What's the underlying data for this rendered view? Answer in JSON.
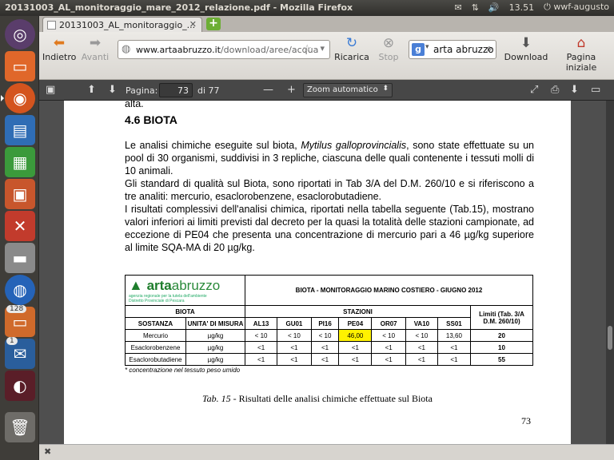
{
  "topbar": {
    "title": "20131003_AL_monitoraggio_mare_2012_relazione.pdf - Mozilla Firefox",
    "time": "13.51",
    "user": "wwf-augusto"
  },
  "launcher": {
    "badge_files": "128",
    "badge_thunderbird": "1"
  },
  "tab": {
    "title": "20131003_AL_monitoraggio_..."
  },
  "nav": {
    "back": "Indietro",
    "forward": "Avanti",
    "reload": "Ricarica",
    "stop": "Stop",
    "download": "Download",
    "home": "Pagina iniziale"
  },
  "url": {
    "domain": "www.artaabruzzo.it",
    "path": "/download/aree/acqua"
  },
  "search": {
    "value": "arta abruzzo"
  },
  "pdf": {
    "page_label": "Pagina:",
    "page_value": "73",
    "page_of": "di 77",
    "zoom": "Zoom automatico"
  },
  "doc": {
    "prev_line": "alta.",
    "heading": "4.6 BIOTA",
    "p1_pre": "Le analisi chimiche eseguite sul biota, ",
    "p1_species": "Mytilus galloprovincialis",
    "p1_post": ", sono state effettuate su un pool di 30 organismi, suddivisi in 3 repliche, ciascuna delle quali contenente i tessuti molli di 10 animali.",
    "p2": "Gli standard di qualità sul Biota, sono riportati in Tab 3/A del D.M. 260/10 e si riferiscono a tre analiti: mercurio, esaclorobenzene, esaclorobutadiene.",
    "p3": "I risultati complessivi dell'analisi chimica, riportati nella tabella seguente (Tab.15), mostrano valori inferiori ai limiti previsti dal decreto per la quasi la totalità delle stazioni campionate, ad eccezione di PE04 che presenta una concentrazione di mercurio pari a 46 µg/kg superiore al limite SQA-MA di 20 µg/kg.",
    "table": {
      "logo_bold": "arta",
      "logo_light": "abruzzo",
      "logo_sub1": "agenzia regionale per la tutela dell'ambiente",
      "logo_sub2": "Distretto Provinciale di Pescara",
      "title": "BIOTA - MONITORAGGIO MARINO COSTIERO - GIUGNO 2012",
      "biota": "BIOTA",
      "stazioni": "STAZIONI",
      "limit": "Limiti (Tab. 3/A D.M. 260/10)",
      "col_sostanza": "SOSTANZA",
      "col_unita": "UNITA' DI MISURA",
      "stations": [
        "AL13",
        "GU01",
        "PI16",
        "PE04",
        "OR07",
        "VA10",
        "SS01"
      ],
      "rows": [
        {
          "name": "Mercurio",
          "unit": "µg/kg",
          "values": [
            "< 10",
            "< 10",
            "< 10",
            "46,00",
            "< 10",
            "< 10",
            "13,60"
          ],
          "limit": "20"
        },
        {
          "name": "Esaclorobenzene",
          "unit": "µg/kg",
          "values": [
            "<1",
            "<1",
            "<1",
            "<1",
            "<1",
            "<1",
            "<1"
          ],
          "limit": "10"
        },
        {
          "name": "Esaclorobutadiene",
          "unit": "µg/kg",
          "values": [
            "<1",
            "<1",
            "<1",
            "<1",
            "<1",
            "<1",
            "<1"
          ],
          "limit": "55"
        }
      ],
      "note": "* concentrazione nel tessuto peso umido"
    },
    "caption_label": "Tab. 15",
    "caption_text": " - Risultati delle analisi chimiche effettuate sul Biota",
    "page_number": "73"
  }
}
